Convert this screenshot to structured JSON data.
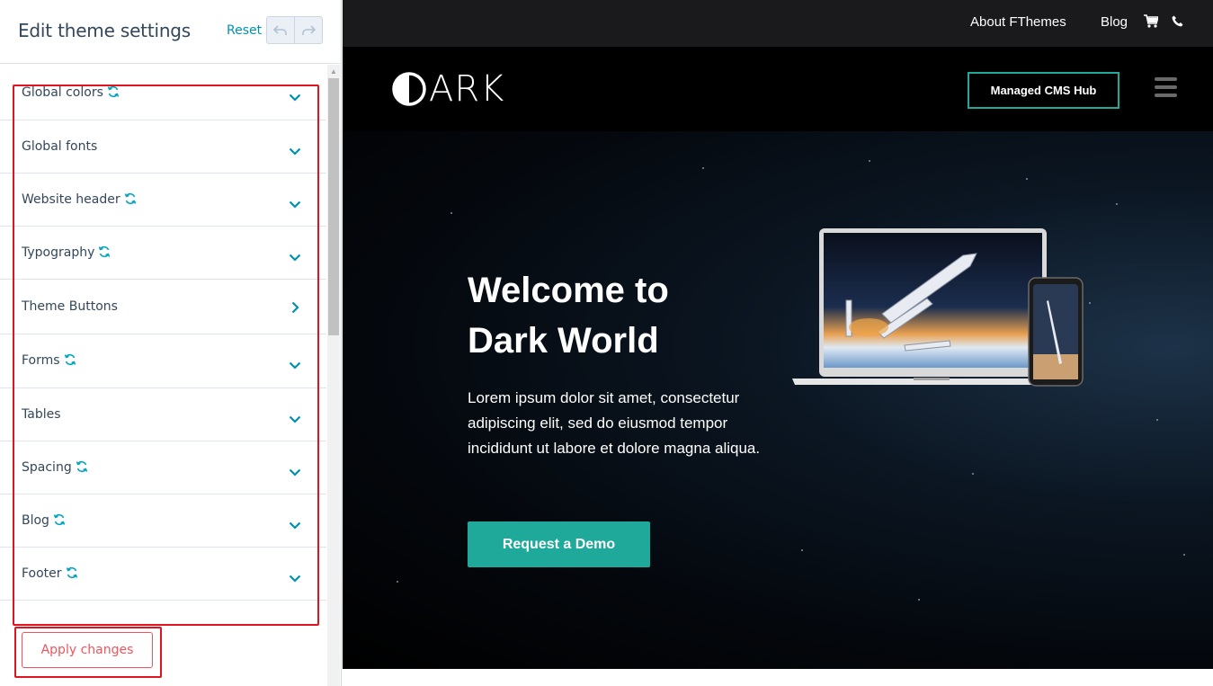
{
  "panel": {
    "title": "Edit theme settings",
    "reset_label": "Reset",
    "undo_icon": "undo-icon",
    "redo_icon": "redo-icon",
    "apply_label": "Apply changes",
    "sections": [
      {
        "label": "Global colors",
        "has_sync": true,
        "chevron": "down"
      },
      {
        "label": "Global fonts",
        "has_sync": false,
        "chevron": "down"
      },
      {
        "label": "Website header",
        "has_sync": true,
        "chevron": "down"
      },
      {
        "label": "Typography",
        "has_sync": true,
        "chevron": "down"
      },
      {
        "label": "Theme Buttons",
        "has_sync": false,
        "chevron": "right"
      },
      {
        "label": "Forms",
        "has_sync": true,
        "chevron": "down"
      },
      {
        "label": "Tables",
        "has_sync": false,
        "chevron": "down"
      },
      {
        "label": "Spacing",
        "has_sync": true,
        "chevron": "down"
      },
      {
        "label": "Blog",
        "has_sync": true,
        "chevron": "down"
      },
      {
        "label": "Footer",
        "has_sync": true,
        "chevron": "down"
      }
    ]
  },
  "preview": {
    "topbar": {
      "links": [
        "About FThemes",
        "Blog"
      ],
      "icons": [
        "cart-icon",
        "phone-icon"
      ]
    },
    "nav": {
      "logo_text": "ARK",
      "cta_label": "Managed CMS Hub",
      "menu_icon": "hamburger-menu-icon"
    },
    "hero": {
      "title": "Welcome to Dark World",
      "body": "Lorem ipsum dolor sit amet, consectetur adipiscing elit, sed do eiusmod tempor incididunt ut labore et dolore magna aliqua.",
      "button_label": "Request a Demo"
    }
  },
  "colors": {
    "accent": "#1fa99b",
    "link": "#0091ae",
    "highlight": "#e0141e",
    "apply": "#f2545b",
    "text_dark": "#33475b"
  }
}
